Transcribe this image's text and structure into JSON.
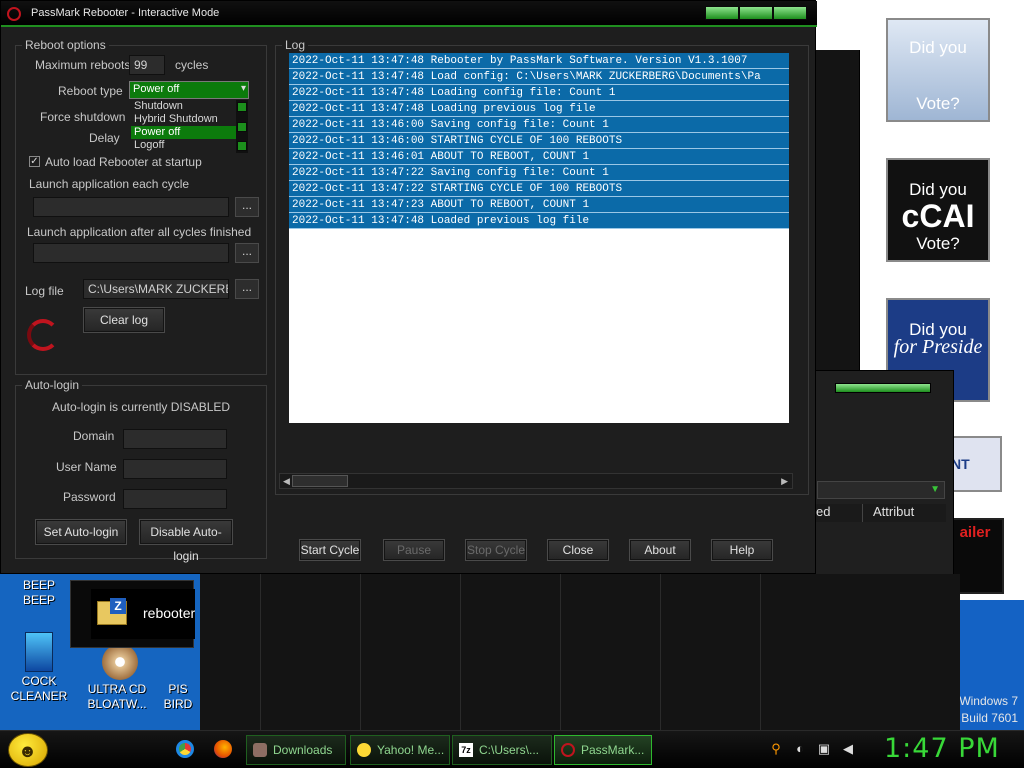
{
  "window": {
    "title": "PassMark Rebooter - Interactive Mode"
  },
  "reboot_options": {
    "group_label": "Reboot options",
    "max_reboots_label": "Maximum reboots",
    "max_reboots_value": "99",
    "cycles_label": "cycles",
    "reboot_type_label": "Reboot type",
    "reboot_type_value": "Power off",
    "reboot_type_options": [
      "Shutdown",
      "Hybrid Shutdown",
      "Power off",
      "Logoff"
    ],
    "force_shutdown_label": "Force shutdown",
    "delay_label": "Delay",
    "auto_load_label": "Auto load Rebooter at startup",
    "auto_load_checked": "✓",
    "launch_each_label": "Launch application each cycle",
    "launch_after_label": "Launch application after all cycles finished",
    "browse_label": "...",
    "log_file_label": "Log file",
    "log_file_value": "C:\\Users\\MARK ZUCKERBE",
    "clear_log_label": "Clear log"
  },
  "auto_login": {
    "group_label": "Auto-login",
    "status": "Auto-login is currently DISABLED",
    "domain_label": "Domain",
    "user_label": "User Name",
    "password_label": "Password",
    "set_label": "Set Auto-login",
    "disable_label": "Disable Auto-login"
  },
  "log": {
    "group_label": "Log",
    "lines": [
      "2022-Oct-11 13:47:48 Rebooter by PassMark Software. Version V1.3.1007",
      "2022-Oct-11 13:47:48 Load config: C:\\Users\\MARK ZUCKERBERG\\Documents\\Pa",
      "2022-Oct-11 13:47:48 Loading config file: Count 1",
      "2022-Oct-11 13:47:48 Loading previous log file",
      "2022-Oct-11 13:46:00 Saving config file: Count 1",
      "2022-Oct-11 13:46:00 STARTING CYCLE OF 100 REBOOTS",
      "2022-Oct-11 13:46:01 ABOUT TO REBOOT, COUNT 1",
      "2022-Oct-11 13:47:22 Saving config file: Count 1",
      "2022-Oct-11 13:47:22 STARTING CYCLE OF 100 REBOOTS",
      "2022-Oct-11 13:47:23 ABOUT TO REBOOT, COUNT 1",
      "2022-Oct-11 13:47:48 Loaded previous log file"
    ]
  },
  "bottom_buttons": {
    "start": "Start Cycle",
    "pause": "Pause",
    "stop": "Stop Cycle",
    "close": "Close",
    "about": "About",
    "help": "Help"
  },
  "desktop": {
    "icons": [
      {
        "label1": "BEEP",
        "label2": "BEEP"
      },
      {
        "label1": "COCK",
        "label2": "CLEANER"
      },
      {
        "label1": "ULTRA CD",
        "label2": "BLOATW..."
      },
      {
        "label1": "PIS",
        "label2": "BIRD"
      }
    ],
    "explorer_label": "rebooter",
    "posters": [
      {
        "line1": "Did you",
        "line2": "Vote?"
      },
      {
        "line1": "Did you",
        "line2": "cCAI",
        "line3": "Vote?"
      },
      {
        "line1": "Did you",
        "line2": "for Preside"
      },
      {
        "line1": "SIDENT"
      },
      {
        "line1": "ailer"
      }
    ],
    "attrib_header": "Attribut",
    "ed_header": "ed",
    "watermark_os": "Windows 7",
    "watermark_build": "Build 7601"
  },
  "taskbar": {
    "items": [
      {
        "label": "Downloads"
      },
      {
        "label": "Yahoo! Me..."
      },
      {
        "label": "C:\\Users\\..."
      },
      {
        "label": "PassMark..."
      }
    ],
    "clock": "1:47 PM"
  },
  "colors": {
    "accent_green": "#1f8f1f",
    "log_blue": "#0b6aa8",
    "clock_green": "#38d838"
  }
}
